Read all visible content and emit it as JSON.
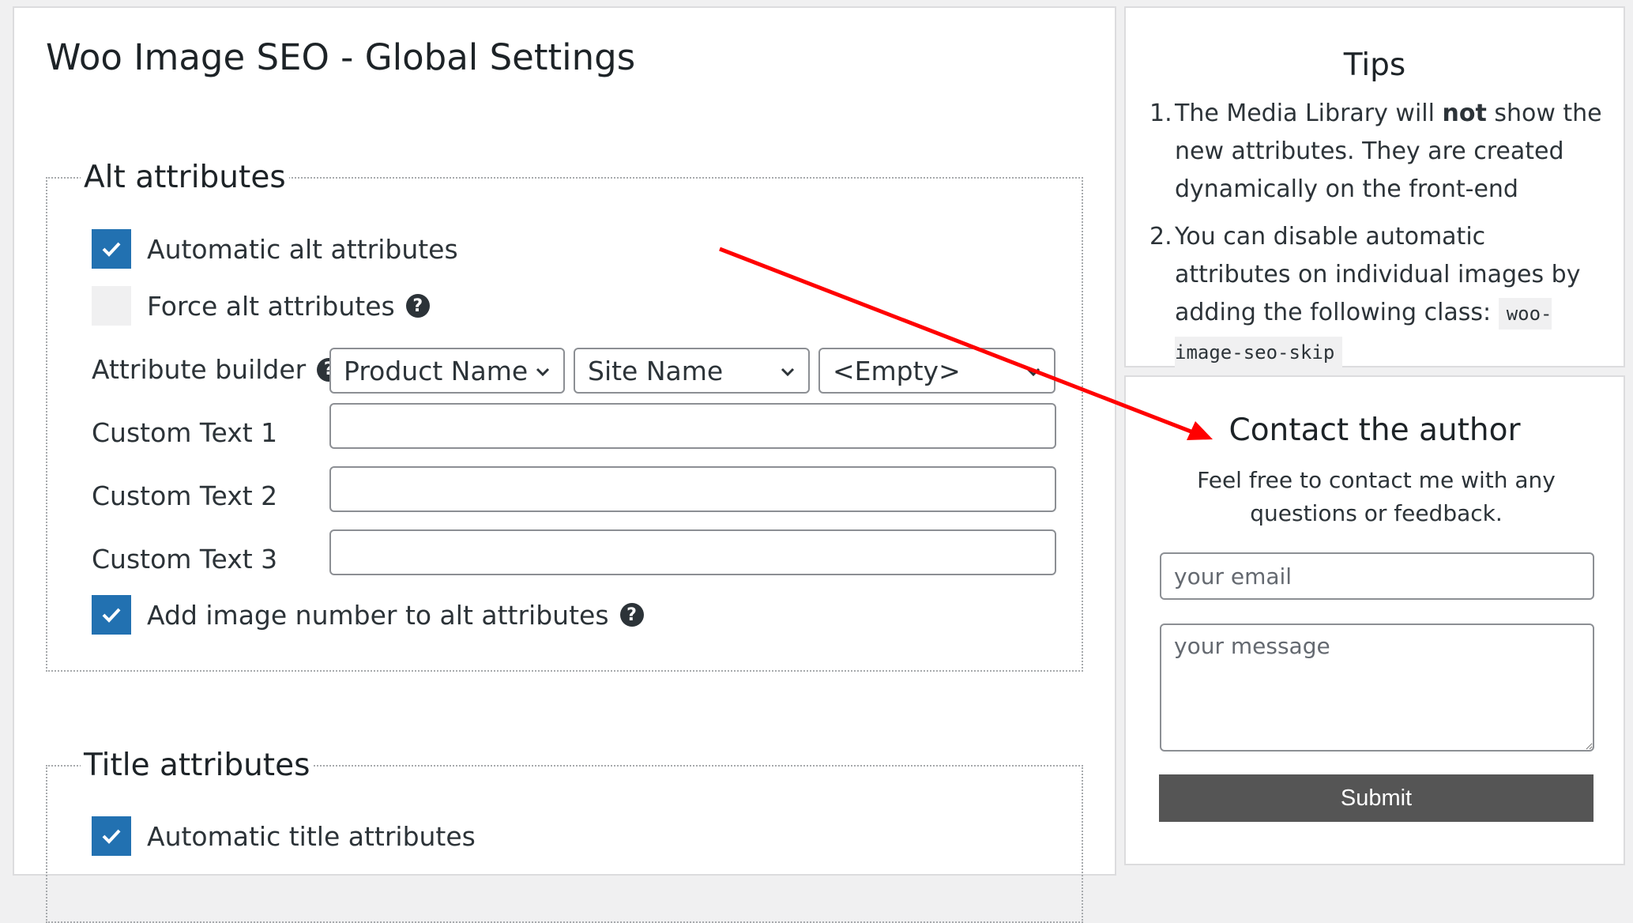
{
  "main": {
    "title": "Woo Image SEO - Global Settings",
    "alt_section": {
      "legend": "Alt attributes",
      "automatic_label": "Automatic alt attributes",
      "automatic_checked": true,
      "force_label": "Force alt attributes",
      "force_checked": false,
      "builder_label": "Attribute builder",
      "builder_selects": [
        "Product Name",
        "Site Name",
        "<Empty>"
      ],
      "custom_text_labels": [
        "Custom Text 1",
        "Custom Text 2",
        "Custom Text 3"
      ],
      "add_number_label": "Add image number to alt attributes",
      "add_number_checked": true
    },
    "title_section": {
      "legend": "Title attributes",
      "automatic_label": "Automatic title attributes",
      "automatic_checked": true
    }
  },
  "tips": {
    "title": "Tips",
    "item1": {
      "num": "1.",
      "before": "The Media Library will ",
      "bold": "not",
      "after": " show the new attributes. They are created dynamically on the front-end"
    },
    "item2": {
      "num": "2.",
      "text": "You can disable automatic attributes on individual images by adding the following class: ",
      "code": "woo-image-seo-skip"
    }
  },
  "contact": {
    "title": "Contact the author",
    "description": "Feel free to contact me with any questions or feedback.",
    "email_placeholder": "your email",
    "message_placeholder": "your message",
    "submit_label": "Submit"
  },
  "colors": {
    "accent": "#2271b1",
    "arrow": "#ff0000",
    "submit_bg": "#555555"
  }
}
